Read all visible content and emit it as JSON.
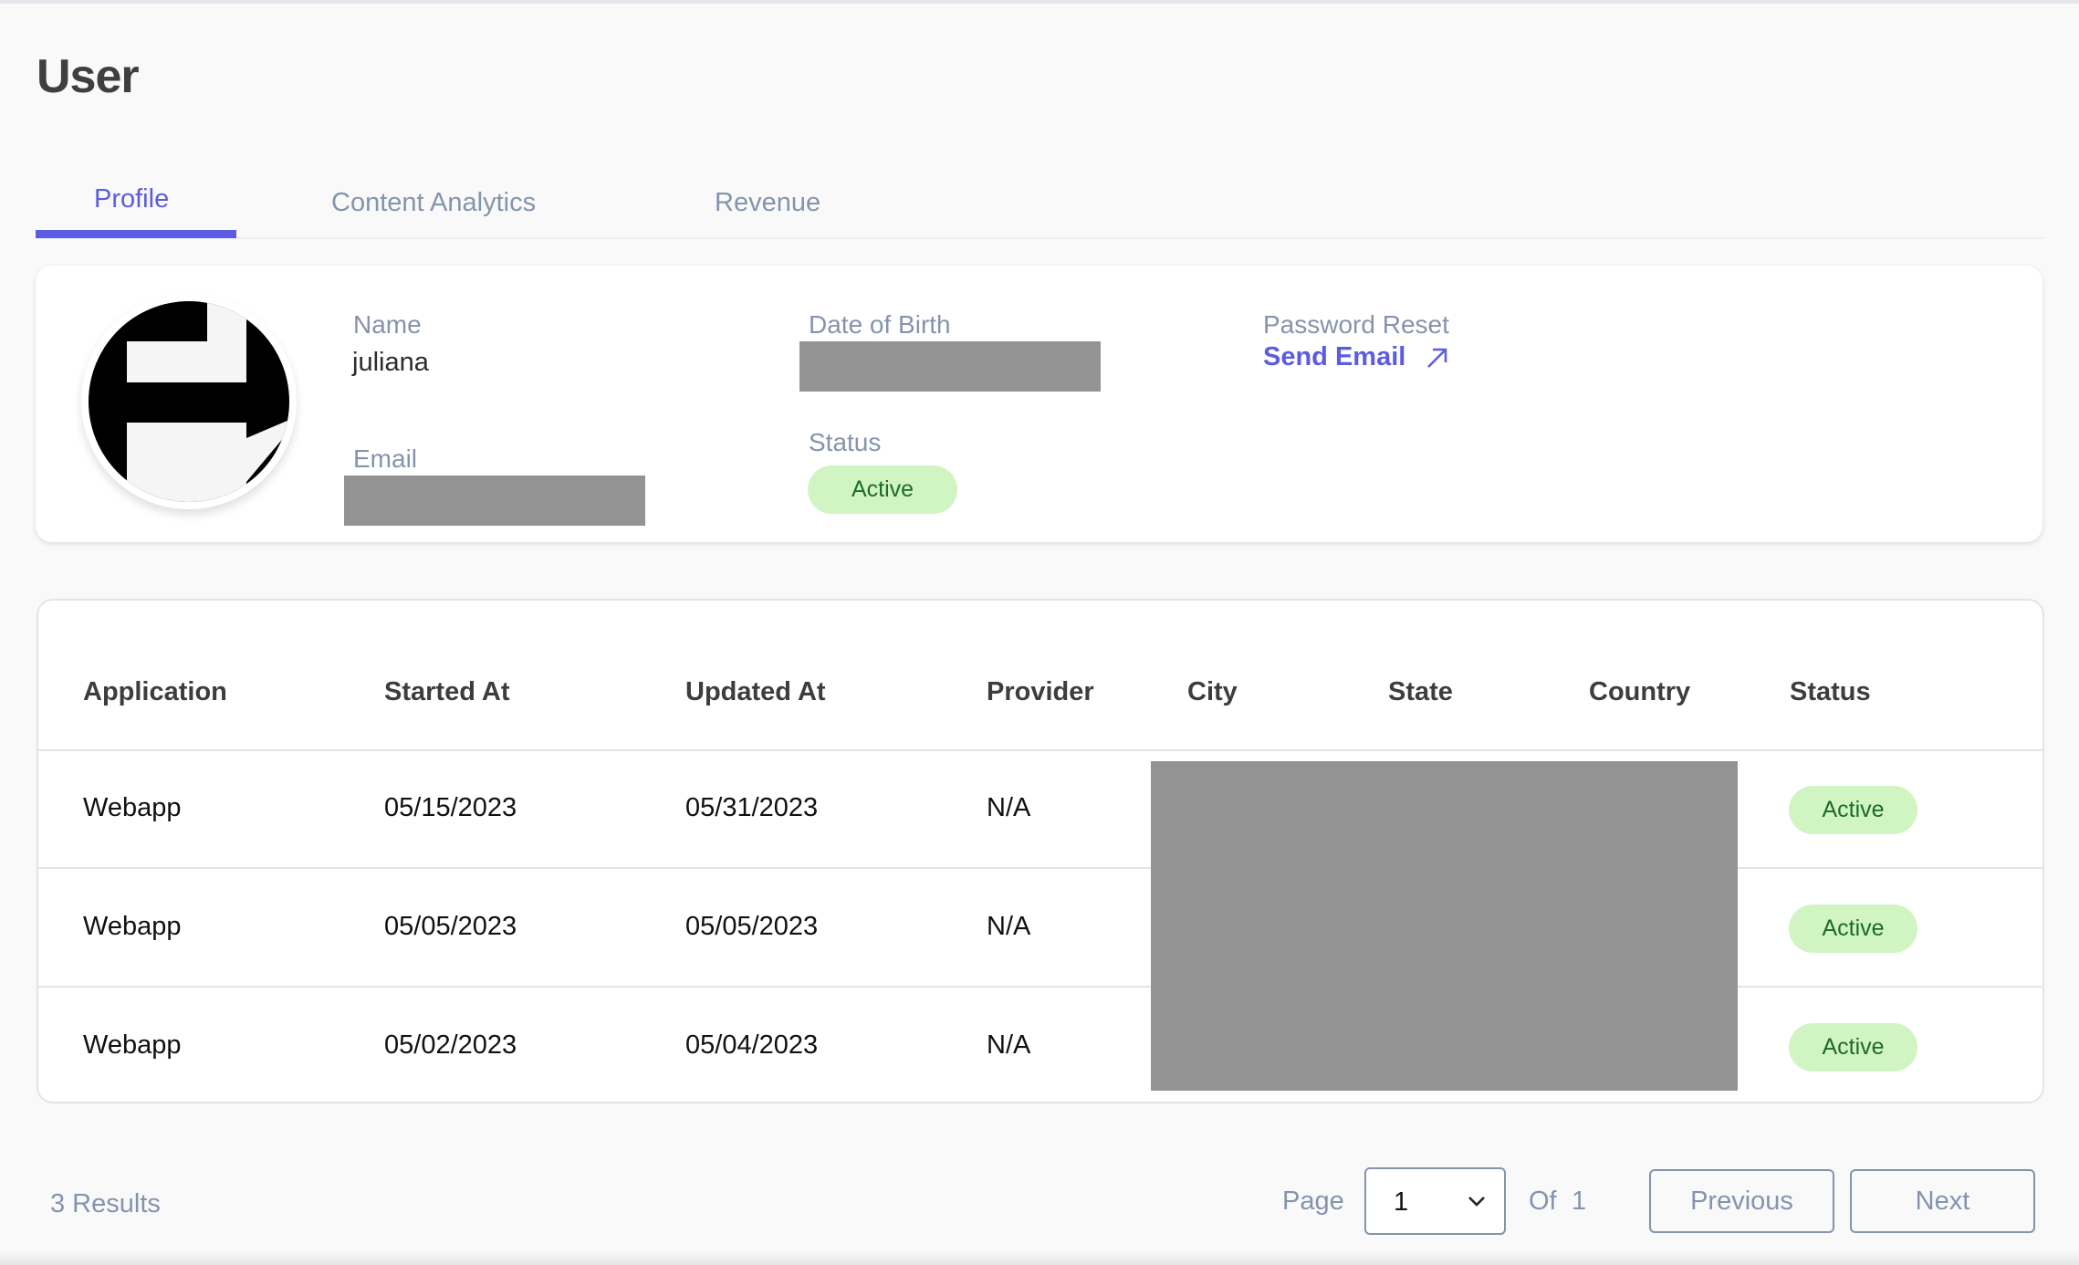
{
  "header": {
    "title": "User"
  },
  "tabs": [
    {
      "label": "Profile",
      "active": true
    },
    {
      "label": "Content Analytics",
      "active": false
    },
    {
      "label": "Revenue",
      "active": false
    }
  ],
  "profile": {
    "name_label": "Name",
    "name_value": "juliana",
    "email_label": "Email",
    "dob_label": "Date of Birth",
    "status_label": "Status",
    "status_value": "Active",
    "password_reset_label": "Password Reset",
    "send_email_label": "Send Email",
    "send_email_icon": "arrow-up-right-icon"
  },
  "table": {
    "columns": [
      "Application",
      "Started At",
      "Updated At",
      "Provider",
      "City",
      "State",
      "Country",
      "Status"
    ],
    "rows": [
      {
        "application": "Webapp",
        "started_at": "05/15/2023",
        "updated_at": "05/31/2023",
        "provider": "N/A",
        "status": "Active"
      },
      {
        "application": "Webapp",
        "started_at": "05/05/2023",
        "updated_at": "05/05/2023",
        "provider": "N/A",
        "status": "Active"
      },
      {
        "application": "Webapp",
        "started_at": "05/02/2023",
        "updated_at": "05/04/2023",
        "provider": "N/A",
        "status": "Active"
      }
    ]
  },
  "pagination": {
    "results": "3 Results",
    "page_label": "Page",
    "current_page": "1",
    "of_label": "Of",
    "total_pages": "1",
    "previous_label": "Previous",
    "next_label": "Next"
  },
  "colors": {
    "accent": "#5b5ce2",
    "muted_text": "#8494ad",
    "badge_bg": "#d1f5c2",
    "badge_text": "#1d6b2a",
    "redaction": "#939393"
  }
}
